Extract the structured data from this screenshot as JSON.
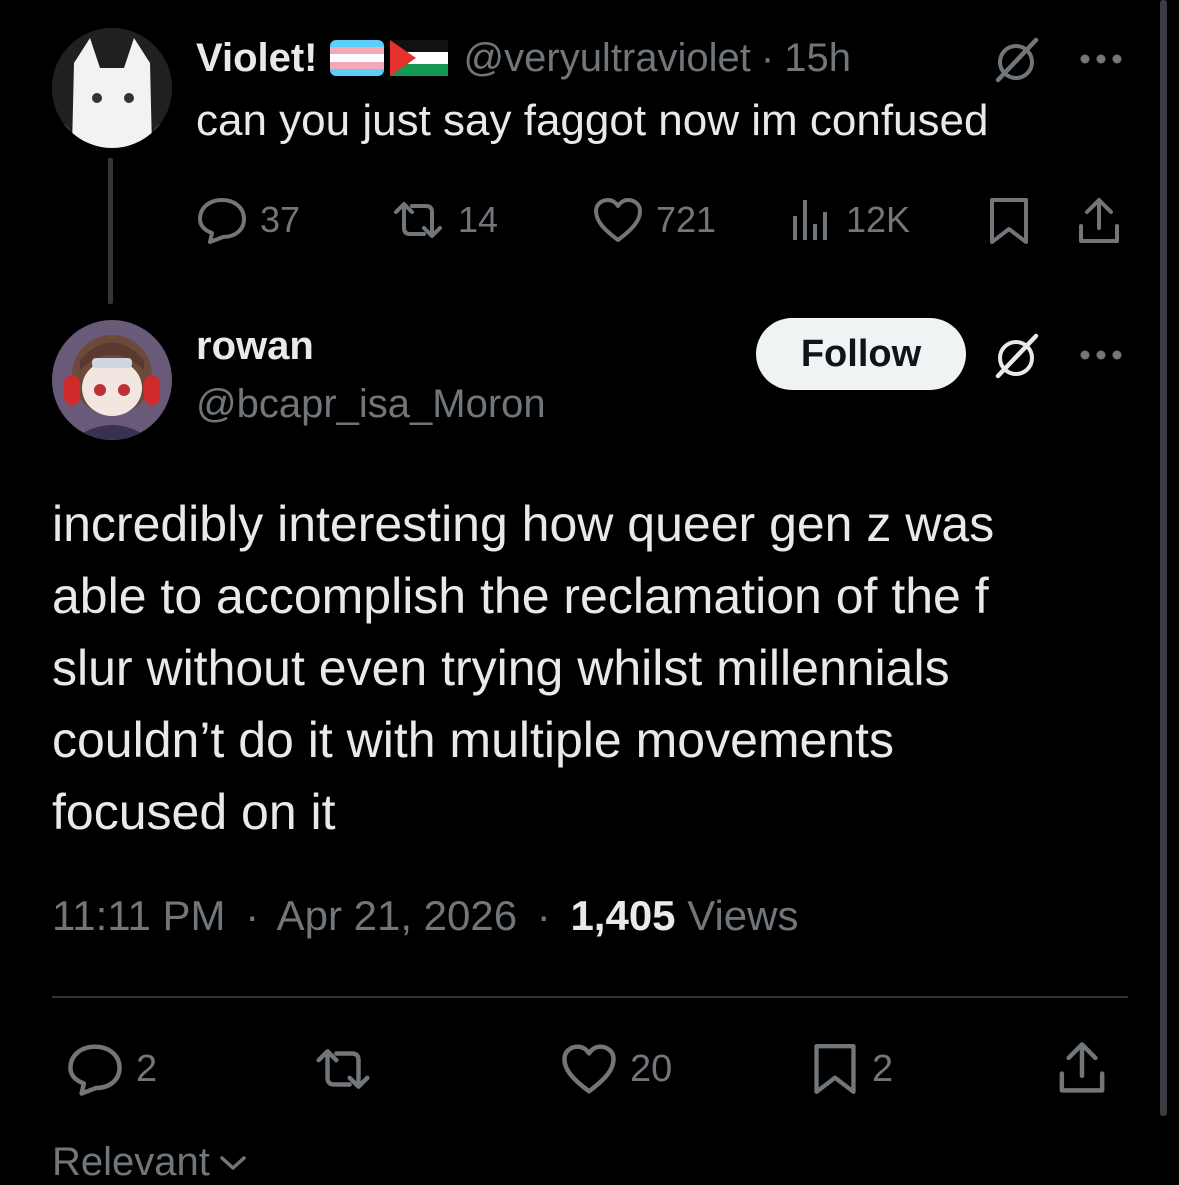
{
  "parent_tweet": {
    "display_name": "Violet!",
    "handle": "@veryultraviolet",
    "separator": "·",
    "time": "15h",
    "text": "can you just say faggot now im confused",
    "stats": {
      "replies": "37",
      "reposts": "14",
      "likes": "721",
      "views": "12K"
    },
    "avatar_icon": "cat-avatar",
    "flag_icons": [
      "trans-flag-icon",
      "palestine-flag-icon"
    ]
  },
  "main_tweet": {
    "display_name": "rowan",
    "handle": "@bcapr_isa_Moron",
    "follow_label": "Follow",
    "text_lines": [
      "incredibly interesting how queer gen z was",
      "able to accomplish the reclamation of the f",
      "slur without even trying whilst millennials",
      "couldn’t do it with multiple movements",
      "focused on it"
    ],
    "meta": {
      "time": "11:11 PM",
      "sep1": "·",
      "date": "Apr 21, 2026",
      "sep2": "·",
      "views_count": "1,405",
      "views_label": "Views"
    },
    "stats": {
      "replies": "2",
      "likes": "20",
      "bookmarks": "2"
    },
    "avatar_icon": "anime-character-avatar"
  },
  "sort": {
    "label": "Relevant"
  },
  "colors": {
    "background": "#000000",
    "text": "#e7e9ea",
    "muted": "#71767b",
    "divider": "#2f3336",
    "follow_bg": "#eff3f4"
  }
}
